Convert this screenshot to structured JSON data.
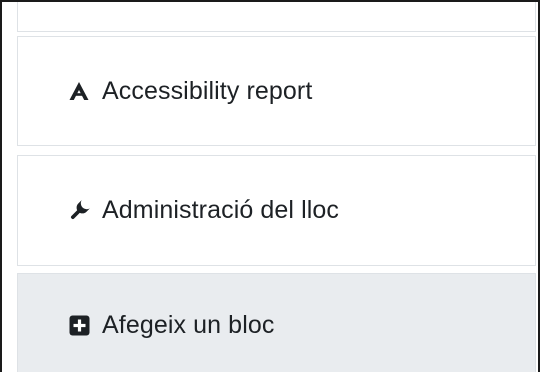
{
  "block_menu": {
    "items": [
      {
        "label": "Accessibility report",
        "icon": "accessibility-icon"
      },
      {
        "label": "Administració del lloc",
        "icon": "wrench-icon"
      },
      {
        "label": "Afegeix un bloc",
        "icon": "plus-square-icon"
      }
    ]
  },
  "colors": {
    "text": "#1d2125",
    "border": "#dee2e6",
    "active_background": "#e9ecef"
  }
}
